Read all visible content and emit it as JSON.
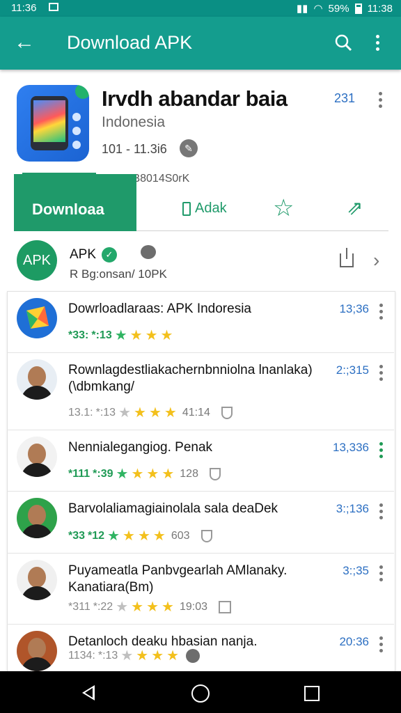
{
  "status_bar": {
    "time_left": "11:36",
    "battery": "59%",
    "time_right": "11:38"
  },
  "app_bar": {
    "title": "Download APK"
  },
  "app": {
    "name": "Irvdh abandar baia",
    "subtitle": "Indonesia",
    "meta": "101 - 11.3i6",
    "code": "DDG0B8014S0rK",
    "count": "231",
    "download_label": "Downloaa",
    "add_label": "Adak"
  },
  "developer": {
    "avatar_text": "APK",
    "name": "APK",
    "subtitle": "R Bg:onsan/ 10PK"
  },
  "list": [
    {
      "title": "Dowrloadlaraas: APK Indoresia",
      "count": "13;36",
      "r1": "*33:",
      "r2": "*:13",
      "stars": [
        "g",
        "y",
        "y",
        "y"
      ],
      "extra": "",
      "badge": "none"
    },
    {
      "title": "Rownlagdestliakachernbnniolna lnanlaka) (\\dbmkang/",
      "count": "2:;315",
      "r1": "13.1:",
      "r2": "*:13",
      "stars": [
        "n",
        "y",
        "y",
        "y"
      ],
      "extra": "41:14",
      "badge": "shield"
    },
    {
      "title": "Nennialegangiog. Penak",
      "count": "13,336",
      "r1": "*111",
      "r2": "*:39",
      "stars": [
        "g",
        "y",
        "y",
        "y"
      ],
      "extra": "128",
      "badge": "shield"
    },
    {
      "title": "Barvolaliamagiainolala sala deaDek",
      "count": "3:;136",
      "r1": "*33",
      "r2": "*12",
      "stars": [
        "g",
        "y",
        "y",
        "y"
      ],
      "extra": "603",
      "badge": "shield"
    },
    {
      "title": "Puyameatla Panbvgearlah AMlanaky. Kanatiara(Bm)",
      "count": "3:;35",
      "r1": "*311",
      "r2": "*:22",
      "stars": [
        "n",
        "y",
        "y",
        "y"
      ],
      "extra": "19:03",
      "badge": "square"
    },
    {
      "title": "Detanloch deaku hbasian nanja.",
      "count": "20:36",
      "r1": "1134:",
      "r2": "*:13",
      "stars": [
        "n",
        "y",
        "y",
        "y"
      ],
      "extra": "",
      "badge": "circle"
    }
  ]
}
